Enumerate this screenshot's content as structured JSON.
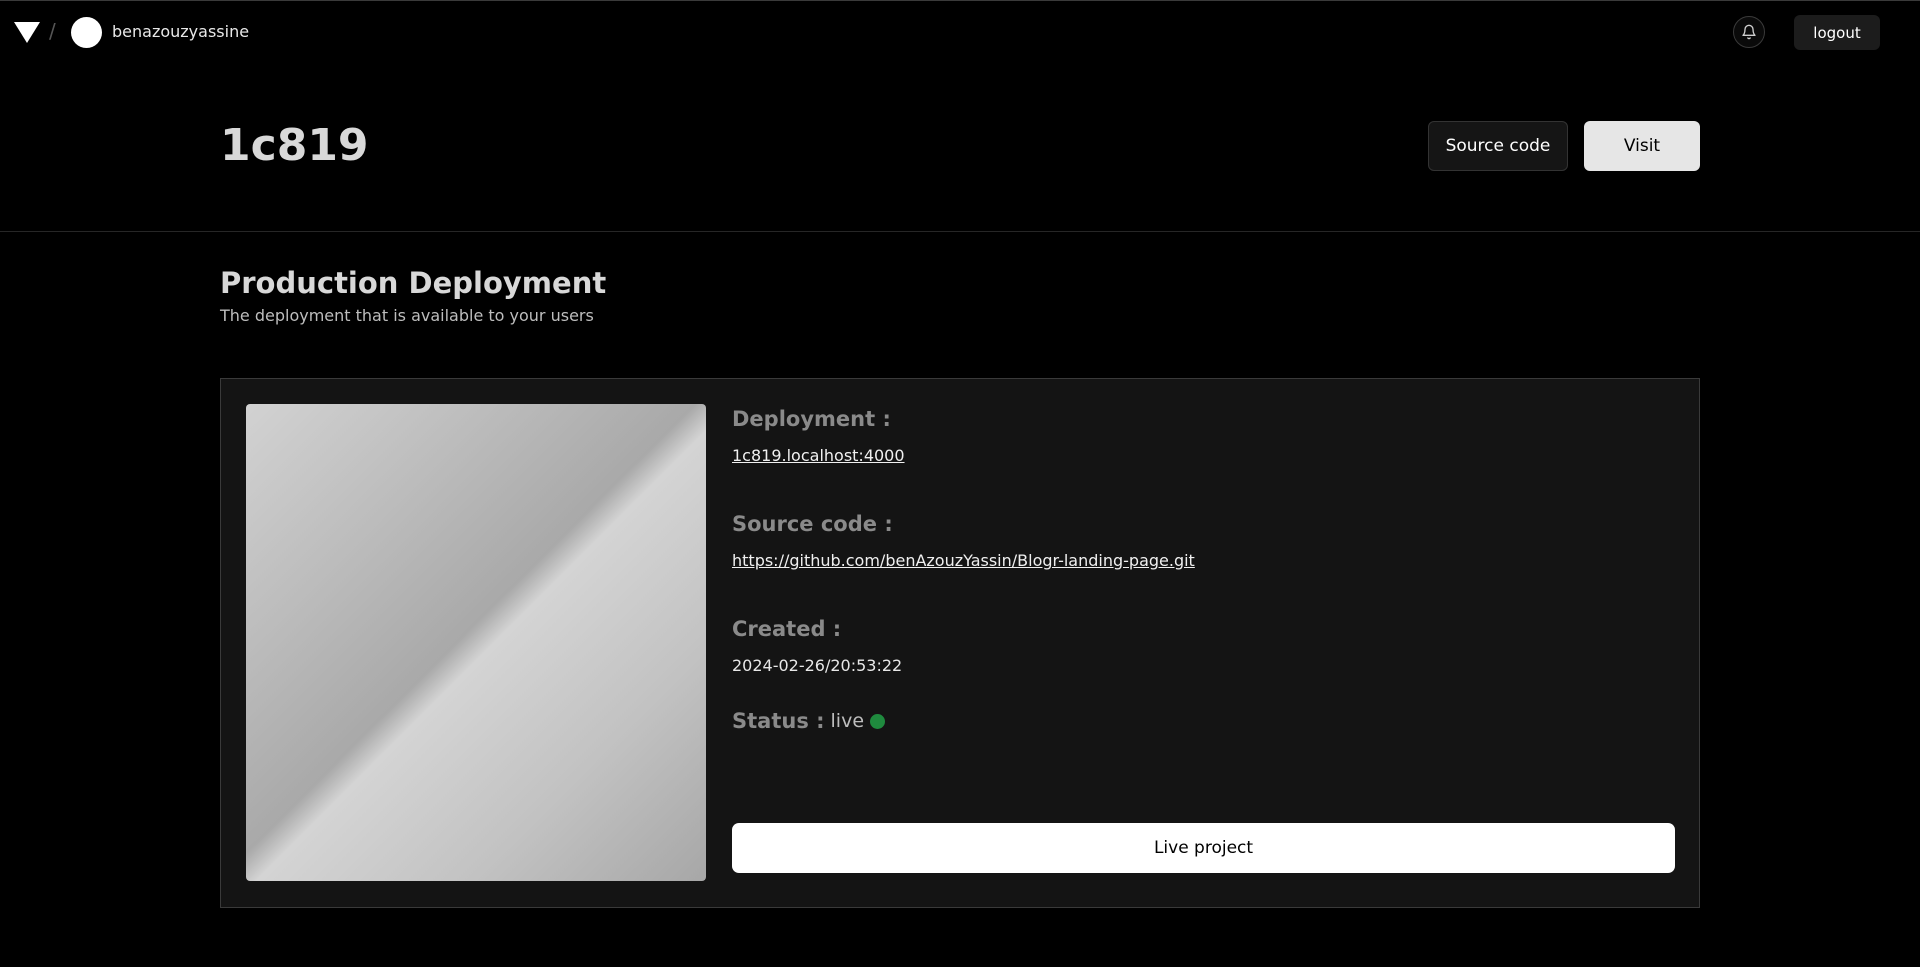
{
  "topbar": {
    "logo_icon": "triangle-logo-icon",
    "separator": "/",
    "username": "benazouzyassine",
    "bell_icon": "bell-icon",
    "logout_label": "logout"
  },
  "header": {
    "project_name": "1c819",
    "source_code_label": "Source code",
    "visit_label": "Visit"
  },
  "section": {
    "title": "Production Deployment",
    "subtitle": "The deployment that is available to your users"
  },
  "deployment": {
    "deployment_label": "Deployment :",
    "deployment_url": "1c819.localhost:4000",
    "source_label": "Source code :",
    "source_url": "https://github.com/benAzouzYassin/Blogr-landing-page.git",
    "created_label": "Created :",
    "created_value": "2024-02-26/20:53:22",
    "status_label": "Status :",
    "status_value": "live",
    "status_color": "#1f8a3e",
    "live_button_label": "Live project"
  }
}
